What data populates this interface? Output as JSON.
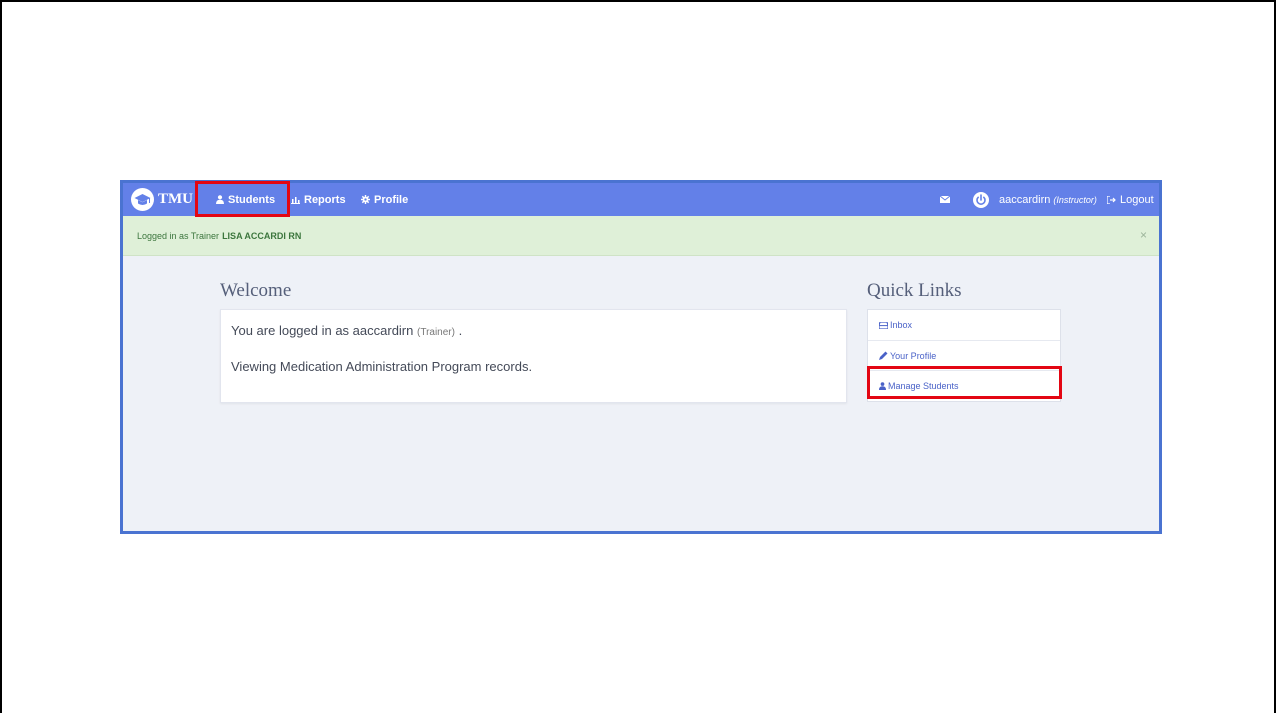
{
  "navbar": {
    "brand": "TMU",
    "items": [
      {
        "label": "Students",
        "icon": "user-icon"
      },
      {
        "label": "Reports",
        "icon": "bar-chart-icon"
      },
      {
        "label": "Profile",
        "icon": "gear-icon"
      }
    ],
    "user": {
      "username": "aaccardirn",
      "role": "(Instructor)"
    },
    "logout": "Logout"
  },
  "alert": {
    "prefix": "Logged in as Trainer",
    "name": "LISA ACCARDI RN",
    "close": "×"
  },
  "welcome": {
    "title": "Welcome",
    "line1_prefix": "You are logged in as aaccardirn",
    "line1_role": "(Trainer)",
    "line1_suffix": " .",
    "line2": "Viewing Medication Administration Program records."
  },
  "quick_links": {
    "title": "Quick Links",
    "items": [
      {
        "label": "Inbox",
        "icon": "inbox-icon"
      },
      {
        "label": "Your Profile",
        "icon": "pencil-icon"
      },
      {
        "label": "Manage Students",
        "icon": "user-icon"
      }
    ]
  },
  "colors": {
    "navbar": "#6380e8",
    "alert_bg": "#dff0d8",
    "highlight": "#e30613",
    "link": "#4a62c8"
  }
}
